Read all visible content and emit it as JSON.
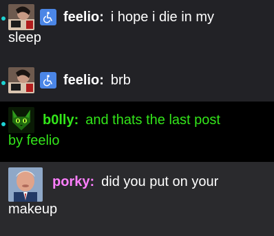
{
  "messages": [
    {
      "username": "feelio",
      "name_color": "#ffffff",
      "text_color": "#ffffff",
      "first_line": "i hope i die in my",
      "wrap": "sleep",
      "badge": "accessibility-icon"
    },
    {
      "username": "feelio",
      "name_color": "#ffffff",
      "text_color": "#ffffff",
      "first_line": "brb",
      "wrap": "",
      "badge": "accessibility-icon"
    },
    {
      "username": "b0lly",
      "name_color": "#33e61a",
      "text_color": "#33e61a",
      "first_line": "and thats the last post",
      "wrap": "by feelio",
      "badge": ""
    },
    {
      "username": "porky",
      "name_color": "#ff7fff",
      "text_color": "#ffffff",
      "first_line": "did you put on your",
      "wrap": "makeup",
      "badge": ""
    }
  ],
  "separator": ":"
}
